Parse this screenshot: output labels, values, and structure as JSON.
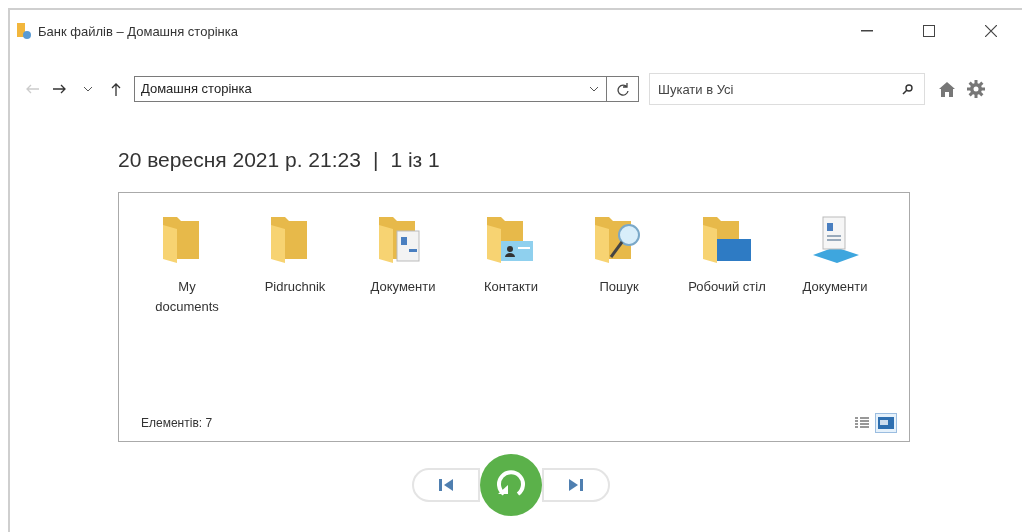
{
  "window": {
    "title": "Банк файлів – Домашня сторінка"
  },
  "toolbar": {
    "back_disabled": true,
    "address": "Домашня сторінка",
    "search": {
      "placeholder": "Шукати в Усі"
    }
  },
  "header": {
    "date": "20 вересня 2021 р. 21:23",
    "separator": "|",
    "page": "1 із 1"
  },
  "items": [
    {
      "kind": "folder",
      "label": "My documents"
    },
    {
      "kind": "folder",
      "label": "Pidruchnik"
    },
    {
      "kind": "folder-doc",
      "label": "Документи"
    },
    {
      "kind": "folder-contact",
      "label": "Контакти"
    },
    {
      "kind": "folder-search",
      "label": "Пошук"
    },
    {
      "kind": "folder-desktop",
      "label": "Робочий стіл"
    },
    {
      "kind": "document",
      "label": "Документи"
    }
  ],
  "status": {
    "count": "Елементів: 7",
    "views": [
      {
        "kind": "details",
        "selected": false
      },
      {
        "kind": "icons",
        "selected": true
      }
    ]
  }
}
